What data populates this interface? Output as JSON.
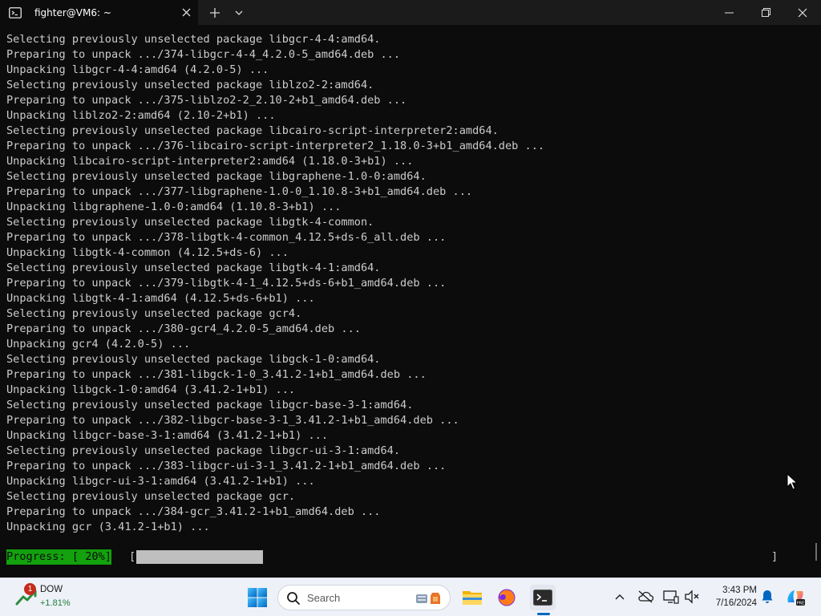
{
  "window": {
    "tab_title": "fighter@VM6: ~",
    "icons": {
      "tab": "terminal-icon",
      "close_tab": "close-icon",
      "new_tab": "plus-icon",
      "dropdown": "chevron-down-icon",
      "minimize": "minimize-icon",
      "maximize": "restore-icon",
      "close": "close-icon"
    }
  },
  "terminal": {
    "lines": [
      "Selecting previously unselected package libgcr-4-4:amd64.",
      "Preparing to unpack .../374-libgcr-4-4_4.2.0-5_amd64.deb ...",
      "Unpacking libgcr-4-4:amd64 (4.2.0-5) ...",
      "Selecting previously unselected package liblzo2-2:amd64.",
      "Preparing to unpack .../375-liblzo2-2_2.10-2+b1_amd64.deb ...",
      "Unpacking liblzo2-2:amd64 (2.10-2+b1) ...",
      "Selecting previously unselected package libcairo-script-interpreter2:amd64.",
      "Preparing to unpack .../376-libcairo-script-interpreter2_1.18.0-3+b1_amd64.deb ...",
      "Unpacking libcairo-script-interpreter2:amd64 (1.18.0-3+b1) ...",
      "Selecting previously unselected package libgraphene-1.0-0:amd64.",
      "Preparing to unpack .../377-libgraphene-1.0-0_1.10.8-3+b1_amd64.deb ...",
      "Unpacking libgraphene-1.0-0:amd64 (1.10.8-3+b1) ...",
      "Selecting previously unselected package libgtk-4-common.",
      "Preparing to unpack .../378-libgtk-4-common_4.12.5+ds-6_all.deb ...",
      "Unpacking libgtk-4-common (4.12.5+ds-6) ...",
      "Selecting previously unselected package libgtk-4-1:amd64.",
      "Preparing to unpack .../379-libgtk-4-1_4.12.5+ds-6+b1_amd64.deb ...",
      "Unpacking libgtk-4-1:amd64 (4.12.5+ds-6+b1) ...",
      "Selecting previously unselected package gcr4.",
      "Preparing to unpack .../380-gcr4_4.2.0-5_amd64.deb ...",
      "Unpacking gcr4 (4.2.0-5) ...",
      "Selecting previously unselected package libgck-1-0:amd64.",
      "Preparing to unpack .../381-libgck-1-0_3.41.2-1+b1_amd64.deb ...",
      "Unpacking libgck-1-0:amd64 (3.41.2-1+b1) ...",
      "Selecting previously unselected package libgcr-base-3-1:amd64.",
      "Preparing to unpack .../382-libgcr-base-3-1_3.41.2-1+b1_amd64.deb ...",
      "Unpacking libgcr-base-3-1:amd64 (3.41.2-1+b1) ...",
      "Selecting previously unselected package libgcr-ui-3-1:amd64.",
      "Preparing to unpack .../383-libgcr-ui-3-1_3.41.2-1+b1_amd64.deb ...",
      "Unpacking libgcr-ui-3-1:amd64 (3.41.2-1+b1) ...",
      "Selecting previously unselected package gcr.",
      "Preparing to unpack .../384-gcr_3.41.2-1+b1_amd64.deb ...",
      "Unpacking gcr (3.41.2-1+b1) ..."
    ],
    "progress": {
      "label": "Progress: [ 20%]",
      "bracket_open": "[",
      "bracket_close": "]",
      "fraction": 0.2
    },
    "colors": {
      "background": "#0c0c0c",
      "text": "#cccccc",
      "progress_label_bg": "#13a10e",
      "progress_fill": "#bfbfbf"
    }
  },
  "taskbar": {
    "widget": {
      "badge": "1",
      "name": "DOW",
      "change": "+1.81%",
      "icon": "stock-chart-icon"
    },
    "search": {
      "placeholder": "Search",
      "icon": "search-icon"
    },
    "apps": [
      {
        "name": "file-explorer",
        "icon": "folder-icon"
      },
      {
        "name": "firefox",
        "icon": "firefox-icon"
      },
      {
        "name": "terminal",
        "icon": "terminal-icon",
        "active": true
      }
    ],
    "tray": {
      "icons": [
        "chevron-up-icon",
        "onedrive-offline-icon",
        "display-icon",
        "volume-muted-icon",
        "notification-bell-icon",
        "copilot-icon"
      ]
    },
    "clock": {
      "time": "3:43 PM",
      "date": "7/16/2024"
    }
  }
}
